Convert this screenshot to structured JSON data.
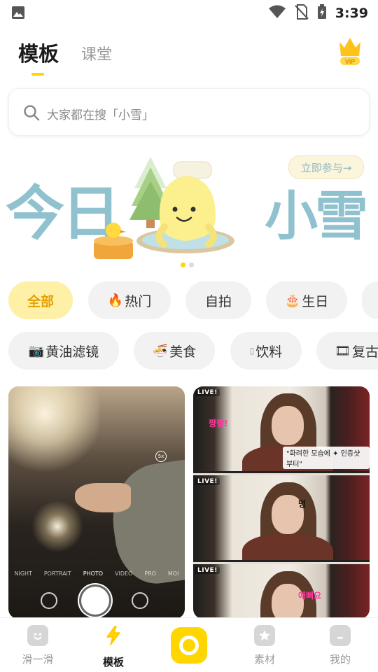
{
  "status_bar": {
    "time": "3:39",
    "icons": [
      "image-icon",
      "wifi-icon",
      "no-sim-icon",
      "battery-charging-icon"
    ]
  },
  "top_tabs": {
    "active": "模板",
    "inactive": "课堂",
    "vip_label": "VIP"
  },
  "search": {
    "placeholder": "大家都在搜「小雪」"
  },
  "banner": {
    "title_left": "今日",
    "title_right": "小雪",
    "join_label": "立即参与→",
    "pages": 2,
    "current_page": 1
  },
  "categories_row1": [
    {
      "label": "全部",
      "emoji": "",
      "active": true
    },
    {
      "label": "热门",
      "emoji": "🔥",
      "active": false
    },
    {
      "label": "自拍",
      "emoji": "",
      "active": false
    },
    {
      "label": "生日",
      "emoji": "🎂",
      "active": false
    }
  ],
  "categories_row2": [
    {
      "label": "黄油滤镜",
      "emoji": "📷"
    },
    {
      "label": "美食",
      "emoji": "🍜"
    },
    {
      "label": "饮料",
      "emoji": "▯"
    },
    {
      "label": "复古",
      "emoji": "🎞"
    }
  ],
  "cards": {
    "left": {
      "modes": [
        "NIGHT",
        "PORTRAIT",
        "PHOTO",
        "VIDEO",
        "PRO",
        "MOI"
      ],
      "selected_mode": "PHOTO",
      "badge": "5x"
    },
    "right": {
      "frames": [
        {
          "live": "LIVE!",
          "caption": "\"화려한 모습에 ✦ 인증샷부터\"",
          "sticker": "짱짱!"
        },
        {
          "live": "LIVE!",
          "caption": "",
          "sticker": "멍"
        },
        {
          "live": "LIVE!",
          "caption": "",
          "sticker": "애뻐요"
        }
      ]
    }
  },
  "bottom_nav": [
    {
      "label": "滑一滑",
      "icon": "smile-icon",
      "active": false
    },
    {
      "label": "模板",
      "icon": "lightning-icon",
      "active": true
    },
    {
      "label": "",
      "icon": "camera-ring-icon",
      "active": false
    },
    {
      "label": "素材",
      "icon": "star-icon",
      "active": false
    },
    {
      "label": "我的",
      "icon": "profile-icon",
      "active": false
    }
  ],
  "colors": {
    "accent": "#FFD600",
    "active_pill_bg": "#FFF0A8",
    "active_pill_text": "#E5A100",
    "banner_text": "#8fc1cf"
  }
}
